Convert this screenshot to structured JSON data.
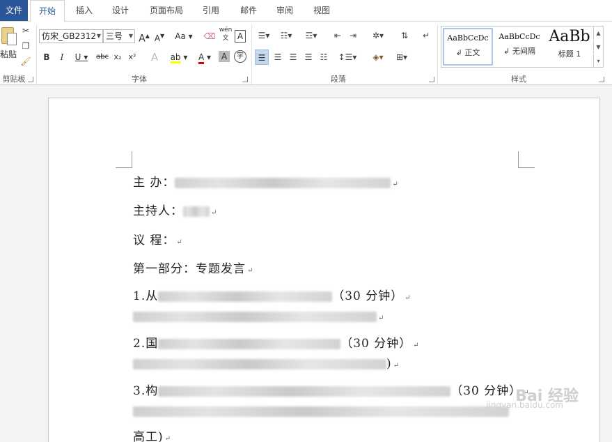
{
  "tabs": [
    "文件",
    "开始",
    "插入",
    "设计",
    "页面布局",
    "引用",
    "邮件",
    "审阅",
    "视图"
  ],
  "ribbon": {
    "clipboard": {
      "paste_label": "粘贴",
      "group_label": "剪贴板"
    },
    "font": {
      "font_name": "仿宋_GB2312",
      "font_size": "三号",
      "group_label": "字体",
      "bold": "B",
      "italic": "I",
      "underline": "U",
      "strike": "abc",
      "subscript": "x₂",
      "superscript": "x²",
      "grow": "A",
      "shrink": "A",
      "case": "Aa",
      "phonetic": "wén",
      "border_char": "A",
      "text_effect": "A",
      "highlight": "ab",
      "font_color": "A",
      "shading": "A",
      "enclose": "字",
      "font_color_hex": "#e00000",
      "highlight_color_hex": "#ffff00"
    },
    "paragraph": {
      "group_label": "段落"
    },
    "styles": {
      "group_label": "样式",
      "items": [
        {
          "preview": "AaBbCcDc",
          "name": "↲ 正文"
        },
        {
          "preview": "AaBbCcDc",
          "name": "↲ 无间隔"
        },
        {
          "preview": "AaBb",
          "name": "标题 1"
        }
      ]
    }
  },
  "document": {
    "lines": [
      {
        "prefix": "主  办：",
        "suffix": ""
      },
      {
        "prefix": "主持人：",
        "suffix": ""
      },
      {
        "prefix": "议  程：",
        "suffix": ""
      },
      {
        "prefix": "第一部分：专题发言",
        "suffix": ""
      },
      {
        "prefix": "1.从",
        "suffix": "（30 分钟）"
      },
      {
        "prefix": "",
        "suffix": ""
      },
      {
        "prefix": "2.国",
        "suffix": "（30 分钟）"
      },
      {
        "prefix": "",
        "suffix": ")"
      },
      {
        "prefix": "3.构",
        "suffix": "（30 分钟）"
      },
      {
        "prefix": "",
        "suffix": ""
      },
      {
        "prefix": "高工)",
        "suffix": ""
      }
    ]
  },
  "watermark": {
    "brand": "Bai 经验",
    "url": "jingyan.baidu.com"
  }
}
